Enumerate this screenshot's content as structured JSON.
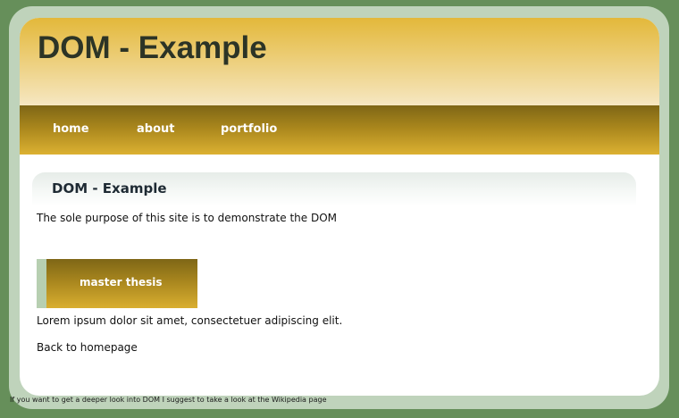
{
  "header": {
    "title": "DOM - Example"
  },
  "nav": {
    "items": [
      {
        "label": "home"
      },
      {
        "label": "about"
      },
      {
        "label": "portfolio"
      }
    ]
  },
  "main": {
    "heading": "DOM - Example",
    "intro": "The sole purpose of this site is to demonstrate the DOM",
    "thesis_button": "master thesis",
    "lorem": "Lorem ipsum dolor sit amet, consectetuer adipiscing elit.",
    "back_link": "Back to homepage"
  },
  "footer": {
    "note": "If you want to get a deeper look into DOM I suggest to take a look at the Wikipedia page"
  },
  "colors": {
    "background": "#668f5a",
    "frame": "#bfd3bb",
    "header_gold": "#e3b83a",
    "nav_dark_gold": "#7e6616",
    "title_text": "#2c3426"
  }
}
